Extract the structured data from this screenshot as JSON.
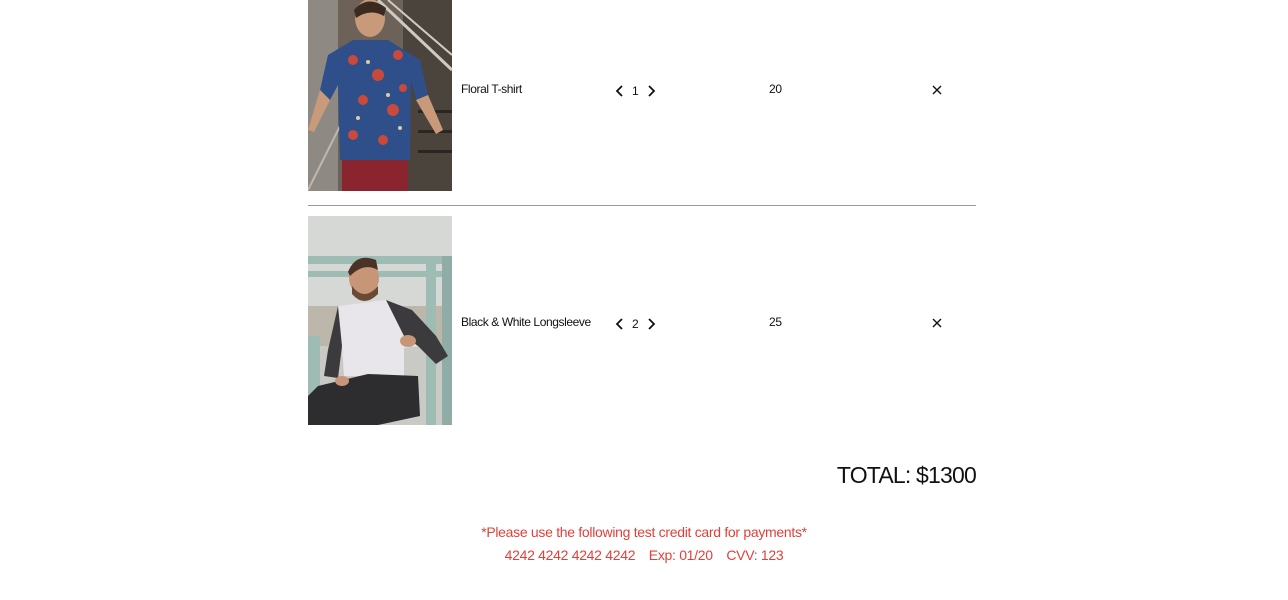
{
  "cart": {
    "items": [
      {
        "name": "Floral T-shirt",
        "quantity": "1",
        "price": "20",
        "image_icon": "man-floral-shirt-photo"
      },
      {
        "name": "Black & White Longsleeve",
        "quantity": "2",
        "price": "25",
        "image_icon": "man-longsleeve-photo"
      }
    ],
    "total_label": "TOTAL: $1300"
  },
  "notice": {
    "line1": "*Please use the following test credit card for payments*",
    "card_number": "4242 4242 4242 4242",
    "expiry": "Exp: 01/20",
    "cvv": "CVV: 123",
    "color": "#e0403a"
  },
  "icons": {
    "decrease": "chevron-left-icon",
    "increase": "chevron-right-icon",
    "remove": "close-icon"
  }
}
